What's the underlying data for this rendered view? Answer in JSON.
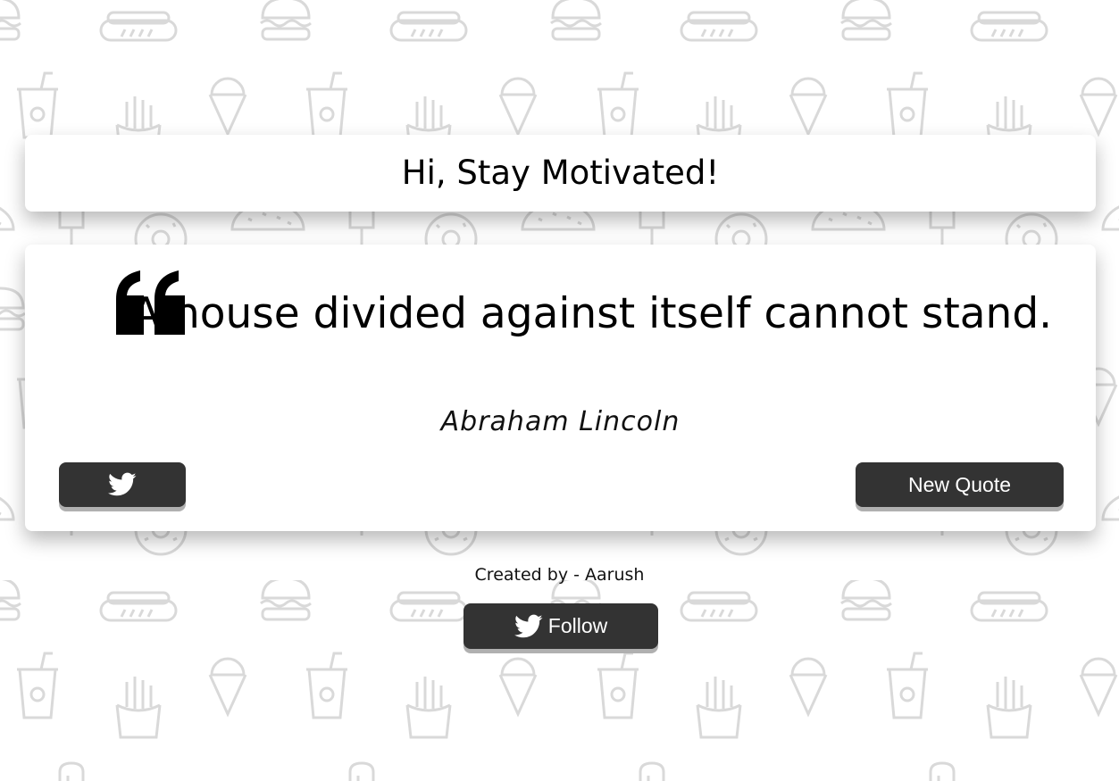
{
  "header": {
    "title": "Hi, Stay Motivated!"
  },
  "quote": {
    "text": "A house divided against itself cannot stand.",
    "author": "Abraham Lincoln"
  },
  "buttons": {
    "tweet_icon": "twitter-icon",
    "new_quote_label": "New Quote",
    "follow_label": "Follow",
    "follow_icon": "twitter-icon"
  },
  "footer": {
    "credit": "Created by - Aarush"
  },
  "colors": {
    "button_bg": "#333333",
    "button_text": "#ffffff",
    "card_bg": "#ffffff",
    "pattern_stroke": "#d9d9d9"
  }
}
